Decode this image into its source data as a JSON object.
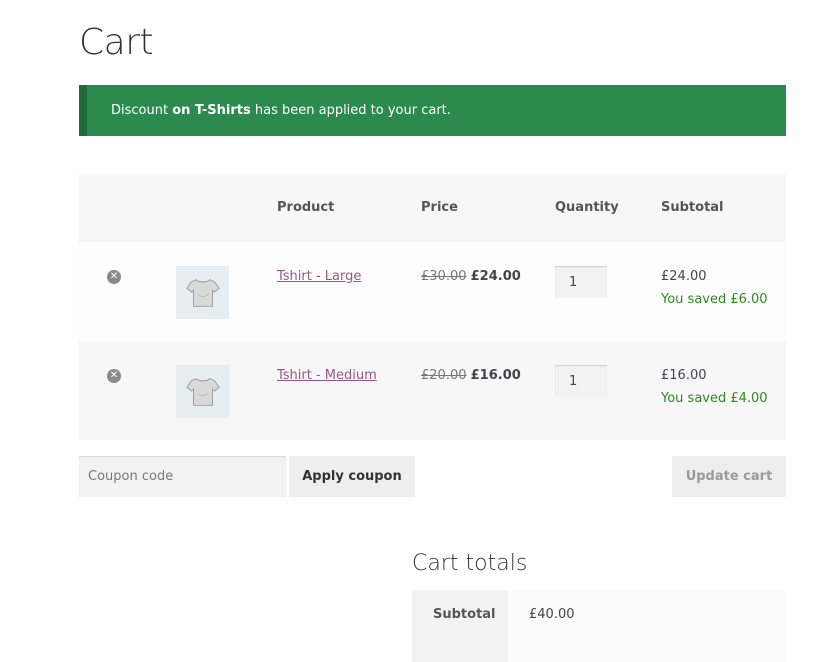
{
  "page": {
    "title": "Cart"
  },
  "notice": {
    "text_before": "Discount ",
    "text_bold": "on T-Shirts",
    "text_after": " has been applied to your cart."
  },
  "table": {
    "headers": {
      "product": "Product",
      "price": "Price",
      "quantity": "Quantity",
      "subtotal": "Subtotal"
    },
    "rows": [
      {
        "remove_icon": "close-circle-icon",
        "thumb_icon": "tshirt-icon",
        "product": "Tshirt - Large",
        "old_price": "£30.00",
        "new_price": "£24.00",
        "quantity": "1",
        "subtotal": "£24.00",
        "saved": "You saved £6.00"
      },
      {
        "remove_icon": "close-circle-icon",
        "thumb_icon": "tshirt-icon",
        "product": "Tshirt - Medium",
        "old_price": "£20.00",
        "new_price": "£16.00",
        "quantity": "1",
        "subtotal": "£16.00",
        "saved": "You saved £4.00"
      }
    ]
  },
  "actions": {
    "coupon_placeholder": "Coupon code",
    "apply_label": "Apply coupon",
    "update_label": "Update cart"
  },
  "totals": {
    "title": "Cart totals",
    "subtotal_label": "Subtotal",
    "subtotal_value": "£40.00"
  },
  "colors": {
    "notice_bg": "#2c8a4e",
    "link": "#96588a",
    "saved": "#2d8a1f"
  }
}
